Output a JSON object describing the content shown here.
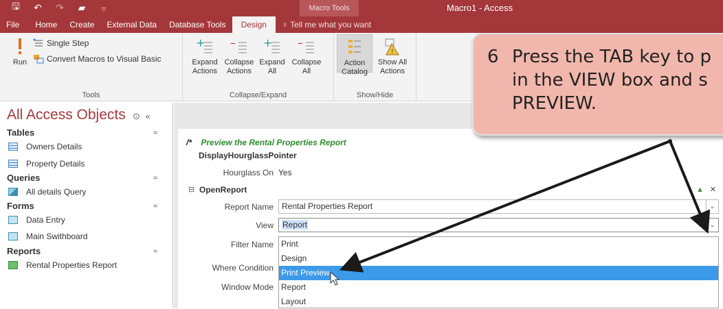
{
  "titlebar": {
    "context_tab": "Macro Tools",
    "window_title": "Macro1 - Access",
    "accent": "#a4373a"
  },
  "qat": {
    "icons": [
      "save-icon",
      "undo-icon",
      "redo-icon",
      "open-icon",
      "customize-icon"
    ]
  },
  "ribbon": {
    "tabs": [
      "File",
      "Home",
      "Create",
      "External Data",
      "Database Tools",
      "Design"
    ],
    "active_tab": "Design",
    "tell_me": "Tell me what you want",
    "groups": {
      "tools": {
        "label": "Tools",
        "run": "Run",
        "single_step": "Single Step",
        "convert": "Convert Macros to Visual Basic"
      },
      "collapse_expand": {
        "label": "Collapse/Expand",
        "expand_actions_1": "Expand",
        "expand_actions_2": "Actions",
        "collapse_actions_1": "Collapse",
        "collapse_actions_2": "Actions",
        "expand_all_1": "Expand",
        "expand_all_2": "All",
        "collapse_all_1": "Collapse",
        "collapse_all_2": "All"
      },
      "show_hide": {
        "label": "Show/Hide",
        "action_catalog_1": "Action",
        "action_catalog_2": "Catalog",
        "show_all_1": "Show All",
        "show_all_2": "Actions"
      }
    }
  },
  "nav": {
    "header": "All Access Objects",
    "sections": [
      {
        "title": "Tables",
        "items": [
          "Owners Details",
          "Property Details"
        ]
      },
      {
        "title": "Queries",
        "items": [
          "All details Query"
        ]
      },
      {
        "title": "Forms",
        "items": [
          "Data Entry",
          "Main Swithboard"
        ]
      },
      {
        "title": "Reports",
        "items": [
          "Rental Properties Report"
        ]
      }
    ]
  },
  "macro": {
    "comment_marker": "/*",
    "comment": "Preview the Rental Properties Report",
    "action1": {
      "name": "DisplayHourglassPointer",
      "arg_label": "Hourglass On",
      "arg_value": "Yes"
    },
    "action2": {
      "name": "OpenReport",
      "report_name_label": "Report Name",
      "report_name_value": "Rental Properties Report",
      "view_label": "View",
      "view_value": "Report",
      "filter_label": "Filter Name",
      "where_label": "Where Condition",
      "window_mode_label": "Window Mode"
    },
    "view_options": [
      "Print",
      "Design",
      "Print Preview",
      "Report",
      "Layout"
    ],
    "highlighted_option": "Print Preview"
  },
  "callout": {
    "number": "6",
    "line1": "Press the TAB key to p",
    "line2": "in the VIEW box and s",
    "line3": "PREVIEW."
  }
}
